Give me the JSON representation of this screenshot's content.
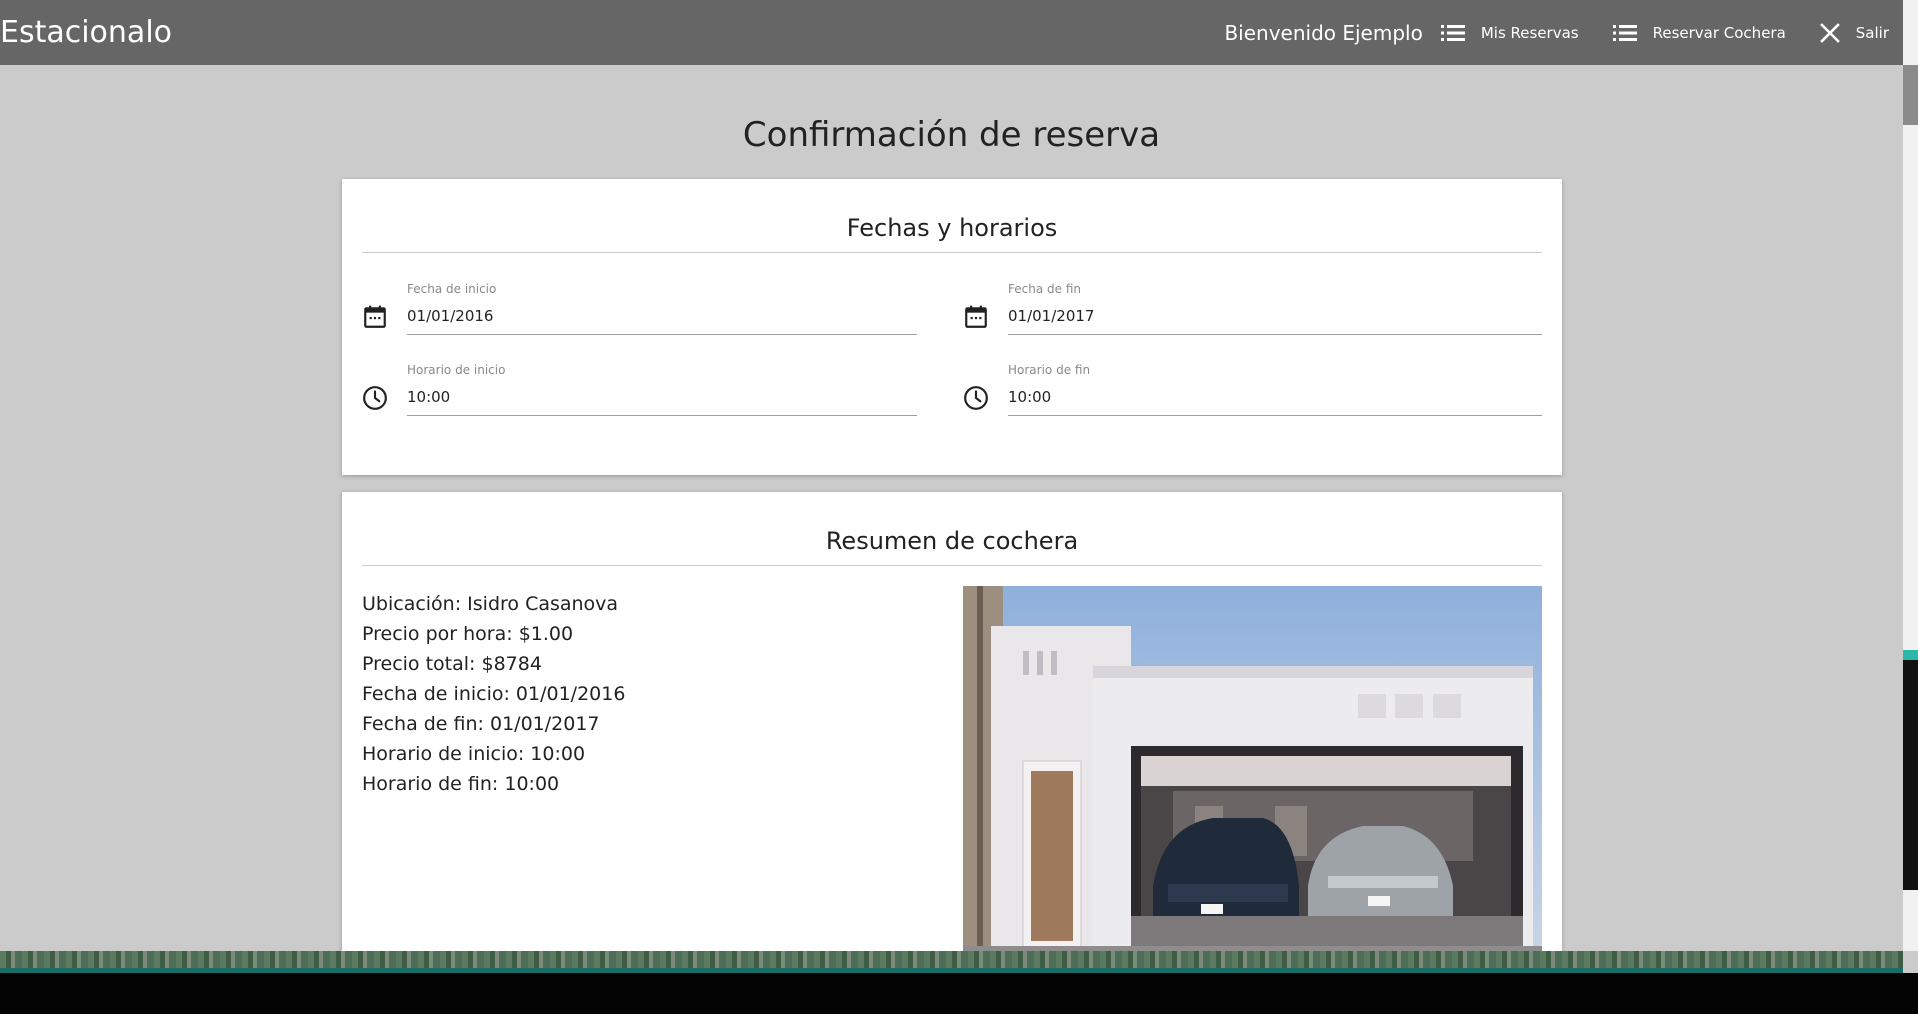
{
  "header": {
    "brand": "Estacionalo",
    "welcome": "Bienvenido Ejemplo",
    "nav": {
      "mis_reservas": "Mis Reservas",
      "reservar_cochera": "Reservar Cochera",
      "salir": "Salir"
    },
    "icons": {
      "mis_reservas": "list-icon",
      "reservar_cochera": "list-icon",
      "salir": "close-icon"
    }
  },
  "page": {
    "title": "Confirmación de reserva"
  },
  "fechas_card": {
    "title": "Fechas y horarios",
    "fecha_inicio": {
      "label": "Fecha de inicio",
      "value": "01/01/2016",
      "icon": "calendar-icon"
    },
    "fecha_fin": {
      "label": "Fecha de fin",
      "value": "01/01/2017",
      "icon": "calendar-icon"
    },
    "horario_inicio": {
      "label": "Horario de inicio",
      "value": "10:00",
      "icon": "clock-icon"
    },
    "horario_fin": {
      "label": "Horario de fin",
      "value": "10:00",
      "icon": "clock-icon"
    }
  },
  "resumen_card": {
    "title": "Resumen de cochera",
    "lines": [
      "Ubicación: Isidro Casanova",
      "Precio por hora: $1.00",
      "Precio total: $8784",
      "Fecha de inicio: 01/01/2016",
      "Fecha de fin: 01/01/2017",
      "Horario de inicio: 10:00",
      "Horario de fin: 10:00"
    ],
    "photo": "garage-photo"
  },
  "colors": {
    "topbar": "#666666",
    "background": "#cbcbcb",
    "card": "#ffffff"
  }
}
